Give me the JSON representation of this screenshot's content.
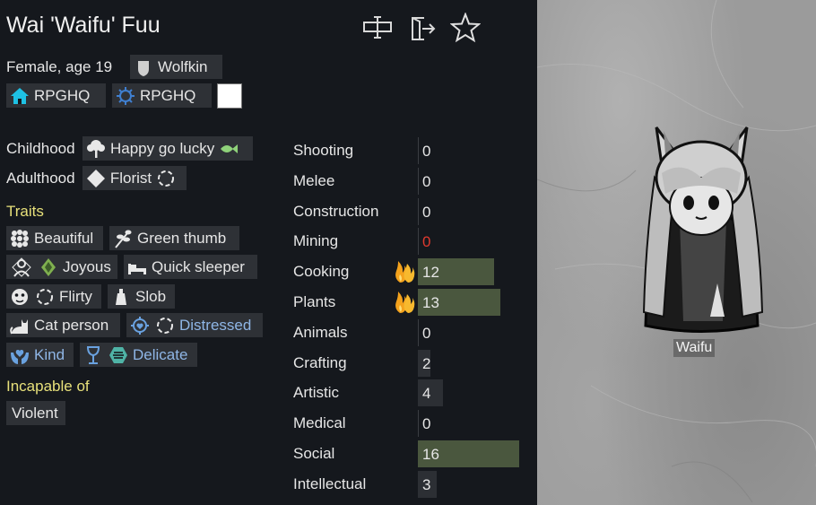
{
  "pawn": {
    "name": "Wai 'Waifu' Fuu",
    "gender_age": "Female, age 19",
    "xenotype": "Wolfkin",
    "faction_1": "RPGHQ",
    "faction_2": "RPGHQ",
    "favorite_color": "#ffffff",
    "map_label": "Waifu"
  },
  "header_icons": [
    "rename-icon",
    "banish-icon",
    "favorite-star-icon"
  ],
  "backstory": {
    "childhood_label": "Childhood",
    "childhood": "Happy go lucky",
    "adulthood_label": "Adulthood",
    "adulthood": "Florist"
  },
  "traits": {
    "heading": "Traits",
    "items": [
      "Beautiful",
      "Green thumb",
      "Joyous",
      "Quick sleeper",
      "Flirty",
      "Slob",
      "Cat person",
      "Distressed",
      "Kind",
      "Delicate"
    ]
  },
  "incapable": {
    "heading": "Incapable of",
    "items": [
      "Violent"
    ]
  },
  "skills": [
    {
      "name": "Shooting",
      "level": 0,
      "passion": "none"
    },
    {
      "name": "Melee",
      "level": 0,
      "passion": "none"
    },
    {
      "name": "Construction",
      "level": 0,
      "passion": "none"
    },
    {
      "name": "Mining",
      "level": 0,
      "passion": "none",
      "disabled": true
    },
    {
      "name": "Cooking",
      "level": 12,
      "passion": "major"
    },
    {
      "name": "Plants",
      "level": 13,
      "passion": "major"
    },
    {
      "name": "Animals",
      "level": 0,
      "passion": "none"
    },
    {
      "name": "Crafting",
      "level": 2,
      "passion": "none"
    },
    {
      "name": "Artistic",
      "level": 4,
      "passion": "none"
    },
    {
      "name": "Medical",
      "level": 0,
      "passion": "none"
    },
    {
      "name": "Social",
      "level": 16,
      "passion": "none"
    },
    {
      "name": "Intellectual",
      "level": 3,
      "passion": "none"
    }
  ],
  "colors": {
    "trait_blue": "#8fb6e6",
    "heading_yellow": "#e7e07a",
    "skill_red": "#e03a2f",
    "bar_passion": "#4a573e",
    "bar_plain": "#2c2f34"
  }
}
